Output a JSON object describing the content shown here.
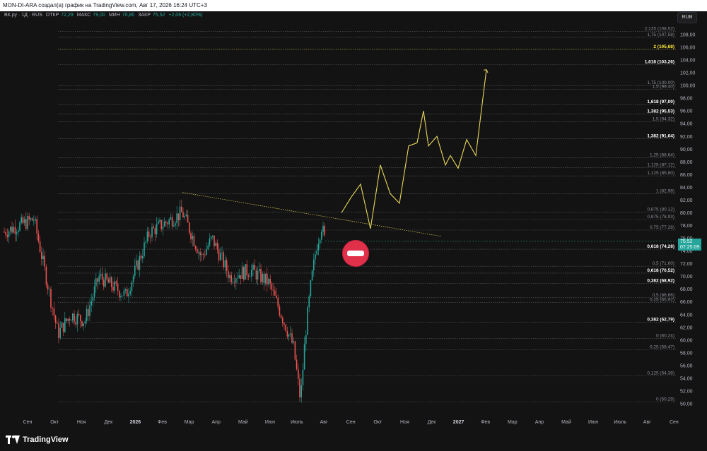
{
  "titlebar": {
    "text": "MON-DI-ARA создал(а) график на TradingView.com, Авг 17, 2026 16:24 UTC+3"
  },
  "symbol": {
    "name": "ВК.ру · 1Д · RUS",
    "open_label": "ОТКР",
    "open": "72,29",
    "high_label": "МАКС",
    "high": "79,00",
    "low_label": "МИН",
    "low": "70,80",
    "close_label": "ЗАКР",
    "close": "75,52",
    "change": "+2,06 (+2,80%)"
  },
  "currency": "RUB",
  "current_price": {
    "value": "75,52",
    "countdown": "07:25:09"
  },
  "price_axis": {
    "labels": [
      "108,00",
      "106,00",
      "104,00",
      "102,00",
      "100,00",
      "98,00",
      "96,00",
      "94,00",
      "92,00",
      "90,00",
      "88,00",
      "86,00",
      "84,00",
      "82,00",
      "80,00",
      "78,00",
      "76,00",
      "74,00",
      "72,00",
      "70,00",
      "68,00",
      "66,00",
      "64,00",
      "62,00",
      "60,00",
      "58,00",
      "56,00",
      "54,00",
      "52,00",
      "50,00"
    ],
    "values": [
      108,
      106,
      104,
      102,
      100,
      98,
      96,
      94,
      92,
      90,
      88,
      86,
      84,
      82,
      80,
      78,
      76,
      74,
      72,
      70,
      68,
      66,
      64,
      62,
      60,
      58,
      56,
      54,
      52,
      50
    ]
  },
  "fib_levels": [
    {
      "text": "2,125 (108,52)",
      "price": 108.52,
      "style": "normal"
    },
    {
      "text": "1,75 (107,58)",
      "price": 107.58,
      "style": "normal"
    },
    {
      "text": "2 (105,68)",
      "price": 105.68,
      "style": "gold"
    },
    {
      "text": "1,618 (103,26)",
      "price": 103.26,
      "style": "bold"
    },
    {
      "text": "1,75 (100,00)",
      "price": 100.0,
      "style": "normal"
    },
    {
      "text": "1,5 (99,40)",
      "price": 99.4,
      "style": "normal"
    },
    {
      "text": "1,618 (97,00)",
      "price": 97.0,
      "style": "bold"
    },
    {
      "text": "1,382 (95,53)",
      "price": 95.53,
      "style": "bold"
    },
    {
      "text": "1,5 (94,32)",
      "price": 94.32,
      "style": "normal"
    },
    {
      "text": "1,382 (91,64)",
      "price": 91.64,
      "style": "bold"
    },
    {
      "text": "1,25 (88,64)",
      "price": 88.64,
      "style": "normal"
    },
    {
      "text": "1,125 (87,12)",
      "price": 87.12,
      "style": "normal"
    },
    {
      "text": "1,125 (85,80)",
      "price": 85.8,
      "style": "normal"
    },
    {
      "text": "1 (82,98)",
      "price": 82.98,
      "style": "normal"
    },
    {
      "text": "0,875 (80,12)",
      "price": 80.12,
      "style": "normal"
    },
    {
      "text": "0,875 (78,93)",
      "price": 78.93,
      "style": "normal"
    },
    {
      "text": "0,75 (77,28)",
      "price": 77.28,
      "style": "normal"
    },
    {
      "text": "0,618 (74,28)",
      "price": 74.28,
      "style": "bold"
    },
    {
      "text": "0,5 (71,60)",
      "price": 71.6,
      "style": "normal"
    },
    {
      "text": "0,618 (70,52)",
      "price": 70.52,
      "style": "bold"
    },
    {
      "text": "0,382 (68,92)",
      "price": 68.92,
      "style": "bold"
    },
    {
      "text": "0,5 (66,66)",
      "price": 66.66,
      "style": "normal"
    },
    {
      "text": "0,25 (65,92)",
      "price": 65.92,
      "style": "normal"
    },
    {
      "text": "0,382 (62,79)",
      "price": 62.79,
      "style": "bold"
    },
    {
      "text": "0 (60,24)",
      "price": 60.24,
      "style": "normal"
    },
    {
      "text": "0,25 (58,47)",
      "price": 58.47,
      "style": "normal"
    },
    {
      "text": "0,125 (54,38)",
      "price": 54.38,
      "style": "normal"
    },
    {
      "text": "0 (50,29)",
      "price": 50.29,
      "style": "normal"
    }
  ],
  "time_axis": [
    {
      "text": "Сен",
      "bold": false
    },
    {
      "text": "Окт",
      "bold": false
    },
    {
      "text": "Ноя",
      "bold": false
    },
    {
      "text": "Дек",
      "bold": false
    },
    {
      "text": "2026",
      "bold": true
    },
    {
      "text": "Фев",
      "bold": false
    },
    {
      "text": "Мар",
      "bold": false
    },
    {
      "text": "Апр",
      "bold": false
    },
    {
      "text": "Май",
      "bold": false
    },
    {
      "text": "Июн",
      "bold": false
    },
    {
      "text": "Июль",
      "bold": false
    },
    {
      "text": "Авг",
      "bold": false
    },
    {
      "text": "Сен",
      "bold": false
    },
    {
      "text": "Окт",
      "bold": false
    },
    {
      "text": "Ноя",
      "bold": false
    },
    {
      "text": "Дек",
      "bold": false
    },
    {
      "text": "2027",
      "bold": true
    },
    {
      "text": "Фев",
      "bold": false
    },
    {
      "text": "Мар",
      "bold": false
    },
    {
      "text": "Апр",
      "bold": false
    },
    {
      "text": "Май",
      "bold": false
    },
    {
      "text": "Июн",
      "bold": false
    },
    {
      "text": "Июль",
      "bold": false
    },
    {
      "text": "Авг",
      "bold": false
    },
    {
      "text": "Сен",
      "bold": false
    }
  ],
  "colors": {
    "up": "#26a69a",
    "down": "#ef5350",
    "projection": "#e8d85a",
    "stop_sign": "#e1314a"
  },
  "branding": {
    "name": "TradingView"
  }
}
